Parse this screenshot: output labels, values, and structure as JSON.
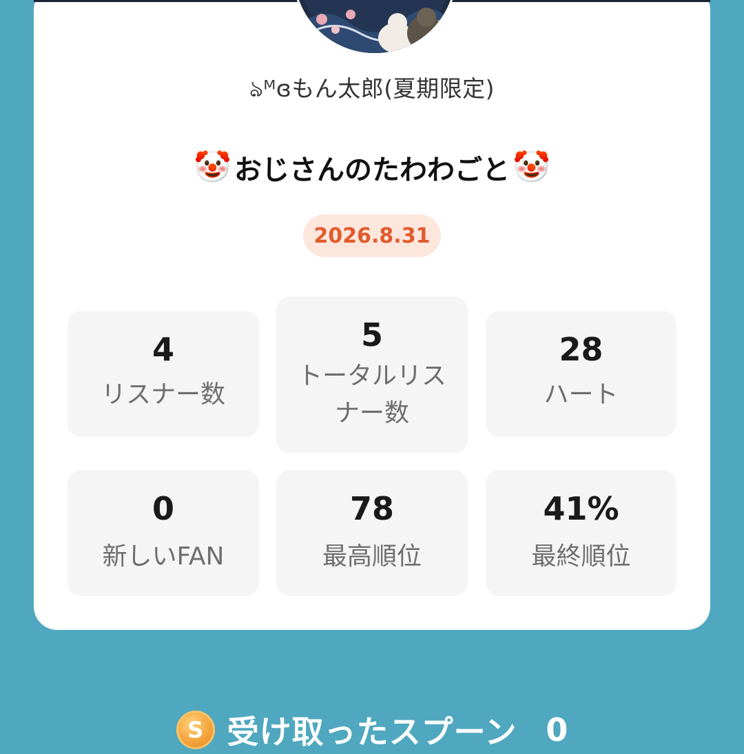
{
  "profile": {
    "username": "ঌᴹɞもん太郎(夏期限定)",
    "avatar_icon": "cat-illustration-avatar"
  },
  "broadcast": {
    "title": "おじさんのたわわごと",
    "title_emoji_left": "🤡",
    "title_emoji_right": "🤡",
    "date": "2026.8.31"
  },
  "stats": [
    {
      "value": "4",
      "label": "リスナー数"
    },
    {
      "value": "5",
      "label": "トータルリス\nナー数"
    },
    {
      "value": "28",
      "label": "ハート"
    },
    {
      "value": "0",
      "label": "新しいFAN"
    },
    {
      "value": "78",
      "label": "最高順位"
    },
    {
      "value": "41%",
      "label": "最終順位"
    }
  ],
  "footer": {
    "coin_letter": "S",
    "label": "受け取ったスプーン",
    "value": "0"
  },
  "colors": {
    "background": "#4fa8bf",
    "card": "#ffffff",
    "date_text": "#e25a2c",
    "date_bg": "#fde7dd",
    "stat_bg": "#f5f5f5"
  }
}
